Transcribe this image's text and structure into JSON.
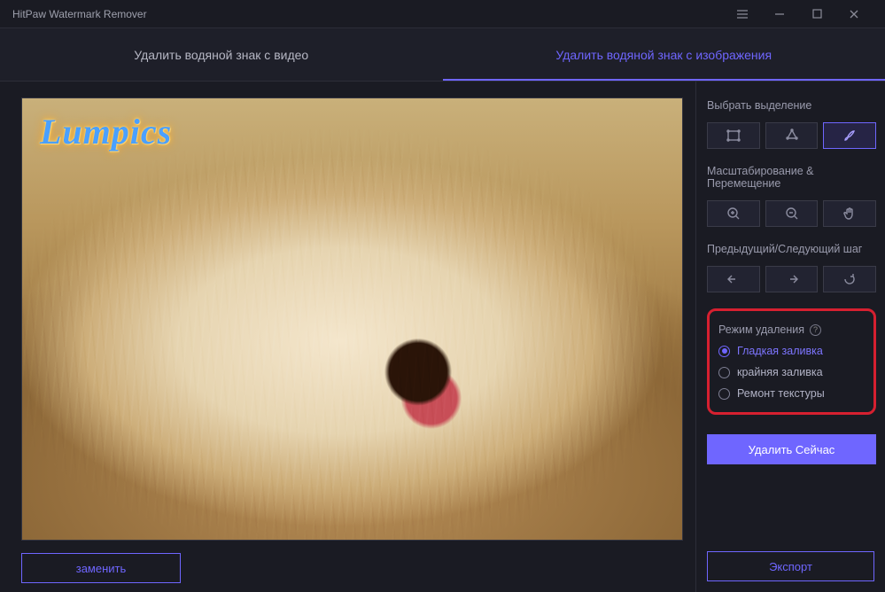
{
  "window": {
    "title": "HitPaw Watermark Remover"
  },
  "tabs": {
    "video": "Удалить водяной знак с видео",
    "image": "Удалить водяной знак с изображения"
  },
  "canvas": {
    "watermark_text": "Lumpics"
  },
  "buttons": {
    "replace": "заменить",
    "remove_now": "Удалить Сейчас",
    "export": "Экспорт"
  },
  "panel": {
    "selection_label": "Выбрать выделение",
    "zoom_label": "Масштабирование & Перемещение",
    "history_label": "Предыдущий/Следующий шаг",
    "mode_label": "Режим удаления",
    "modes": {
      "smooth": "Гладкая заливка",
      "edge": "крайняя заливка",
      "texture": "Ремонт текстуры"
    }
  },
  "icons": {
    "selection": [
      "rectangle-select",
      "lasso-select",
      "brush-select"
    ],
    "zoom": [
      "zoom-in",
      "zoom-out",
      "hand-pan"
    ],
    "history": [
      "undo",
      "redo",
      "reset"
    ]
  },
  "colors": {
    "accent": "#6f66ff",
    "highlight_box": "#d62030"
  }
}
